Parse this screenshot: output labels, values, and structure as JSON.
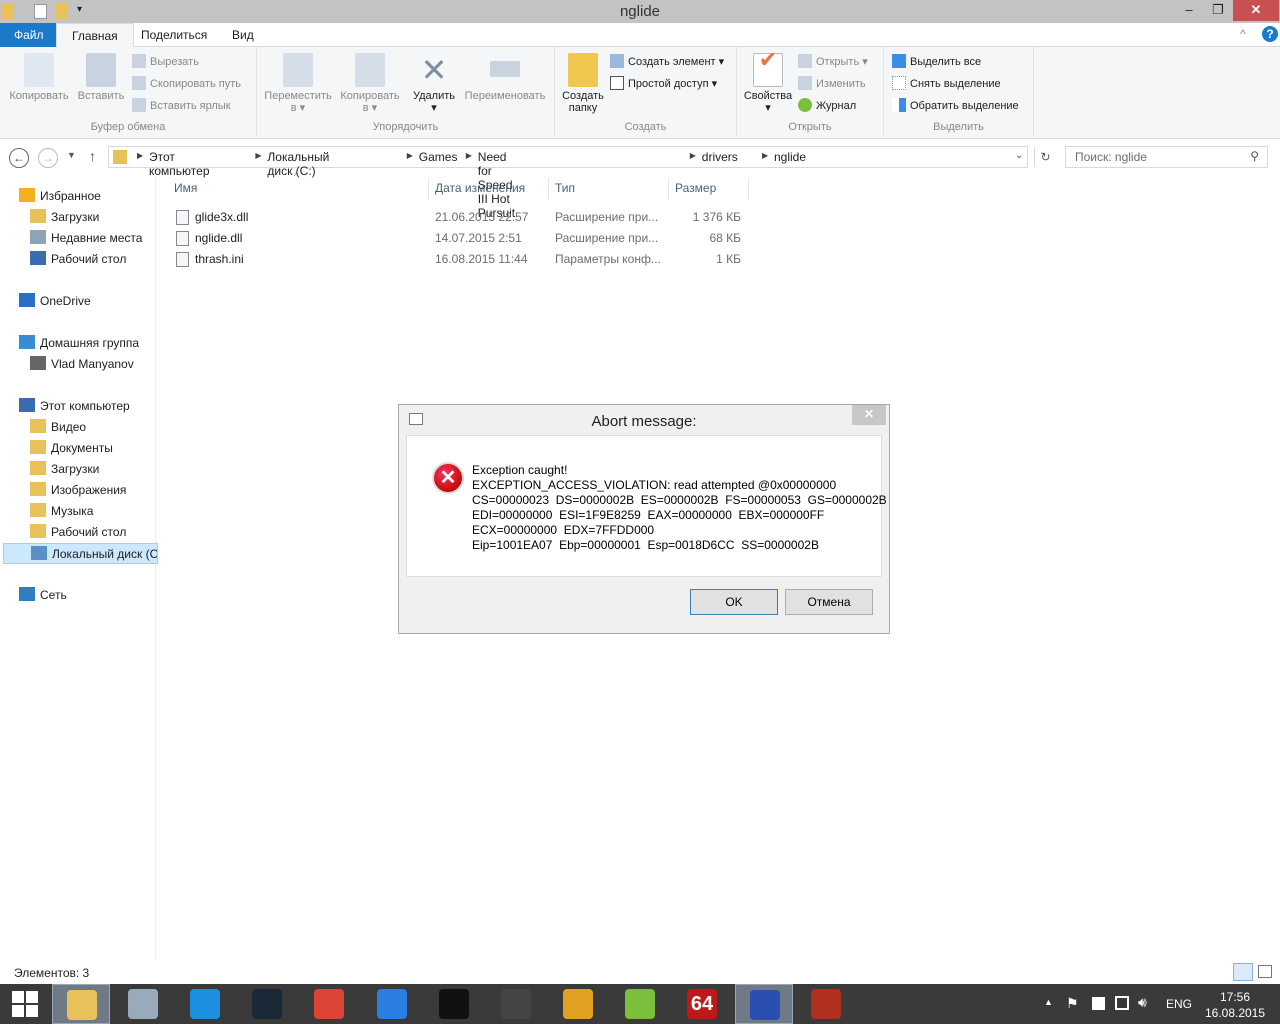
{
  "window": {
    "title": "nglide",
    "minimize": "–",
    "maximize": "❐",
    "close": "✕",
    "help": "?",
    "collapse": "^"
  },
  "tabs": [
    "Файл",
    "Главная",
    "Поделиться",
    "Вид"
  ],
  "ribbon": {
    "clipboard": {
      "label": "Буфер обмена",
      "copy": "Копировать",
      "paste": "Вставить",
      "cut": "Вырезать",
      "copy_path": "Скопировать путь",
      "paste_shortcut": "Вставить ярлык"
    },
    "organize": {
      "label": "Упорядочить",
      "move": "Переместить",
      "move2": "в ▾",
      "copy": "Копировать",
      "copy2": "в ▾",
      "delete": "Удалить",
      "delete2": "▾",
      "rename": "Переименовать"
    },
    "create": {
      "label": "Создать",
      "new_folder": "Создать",
      "new_folder2": "папку",
      "new_item": "Создать элемент ▾",
      "easy_access": "Простой доступ ▾"
    },
    "open": {
      "label": "Открыть",
      "properties": "Свойства",
      "properties2": "▾",
      "open": "Открыть ▾",
      "edit": "Изменить",
      "history": "Журнал"
    },
    "select": {
      "label": "Выделить",
      "all": "Выделить все",
      "none": "Снять выделение",
      "invert": "Обратить выделение"
    }
  },
  "address": {
    "crumbs": [
      "Этот компьютер",
      "Локальный диск (C:)",
      "Games",
      "Need for Speed III Hot Pursuit",
      "drivers",
      "nglide"
    ],
    "search_placeholder": "Поиск: nglide"
  },
  "nav": [
    {
      "label": "Избранное",
      "level": 0,
      "color": "#f2b01e"
    },
    {
      "label": "Загрузки",
      "level": 1,
      "color": "#e8c15a"
    },
    {
      "label": "Недавние места",
      "level": 1,
      "color": "#8ea2b8"
    },
    {
      "label": "Рабочий стол",
      "level": 1,
      "color": "#3b6bb0"
    },
    {
      "label": "OneDrive",
      "level": 0,
      "color": "#2a6fc4",
      "gap": true
    },
    {
      "label": "Домашняя группа",
      "level": 0,
      "color": "#3a8cd0",
      "gap": true
    },
    {
      "label": "Vlad Manyanov",
      "level": 1,
      "color": "#666"
    },
    {
      "label": "Этот компьютер",
      "level": 0,
      "color": "#3b6bb0",
      "gap": true
    },
    {
      "label": "Видео",
      "level": 1,
      "color": "#e8c15a"
    },
    {
      "label": "Документы",
      "level": 1,
      "color": "#e8c15a"
    },
    {
      "label": "Загрузки",
      "level": 1,
      "color": "#e8c15a"
    },
    {
      "label": "Изображения",
      "level": 1,
      "color": "#e8c15a"
    },
    {
      "label": "Музыка",
      "level": 1,
      "color": "#e8c15a"
    },
    {
      "label": "Рабочий стол",
      "level": 1,
      "color": "#e8c15a"
    },
    {
      "label": "Локальный диск (C:)",
      "level": 1,
      "color": "#5a8fc8",
      "selected": true
    },
    {
      "label": "Сеть",
      "level": 0,
      "color": "#2f7fc4",
      "gap": true
    }
  ],
  "columns": {
    "name": "Имя",
    "date": "Дата изменения",
    "type": "Тип",
    "size": "Размер"
  },
  "files": [
    {
      "name": "glide3x.dll",
      "date": "21.06.2015 22:57",
      "type": "Расширение при...",
      "size": "1 376 КБ"
    },
    {
      "name": "nglide.dll",
      "date": "14.07.2015 2:51",
      "type": "Расширение при...",
      "size": "68 КБ"
    },
    {
      "name": "thrash.ini",
      "date": "16.08.2015 11:44",
      "type": "Параметры конф...",
      "size": "1 КБ"
    }
  ],
  "status": "Элементов: 3",
  "dialog": {
    "title": "Abort message:",
    "close": "✕",
    "icon": "error-icon",
    "message": "Exception caught!\nEXCEPTION_ACCESS_VIOLATION: read attempted @0x00000000\nCS=00000023  DS=0000002B  ES=0000002B  FS=00000053  GS=0000002B\nEDI=00000000  ESI=1F9E8259  EAX=00000000  EBX=000000FF\nECX=00000000  EDX=7FFDD000\nEip=1001EA07  Ebp=00000001  Esp=0018D6CC  SS=0000002B",
    "ok": "OK",
    "cancel": "Отмена"
  },
  "taskbar": {
    "items": [
      {
        "name": "start",
        "color": "#ffffff"
      },
      {
        "name": "file-explorer",
        "color": "#e8c15a",
        "active": true
      },
      {
        "name": "task-manager",
        "color": "#9ab"
      },
      {
        "name": "internet-explorer",
        "color": "#1e90e0"
      },
      {
        "name": "steam",
        "color": "#1b2838"
      },
      {
        "name": "chrome",
        "color": "#db4437"
      },
      {
        "name": "app-blue",
        "color": "#2a7de1"
      },
      {
        "name": "app-black",
        "color": "#111"
      },
      {
        "name": "app-clapper",
        "color": "#444"
      },
      {
        "name": "app-lightning",
        "color": "#e0a020"
      },
      {
        "name": "notepad-plus",
        "color": "#7cbf3c"
      },
      {
        "name": "aida64",
        "color": "#c01818",
        "text": "64"
      },
      {
        "name": "app-window",
        "color": "#2a4fb0",
        "active": true
      },
      {
        "name": "app-game",
        "color": "#b03020"
      }
    ],
    "lang": "ENG",
    "time": "17:56",
    "date": "16.08.2015"
  }
}
